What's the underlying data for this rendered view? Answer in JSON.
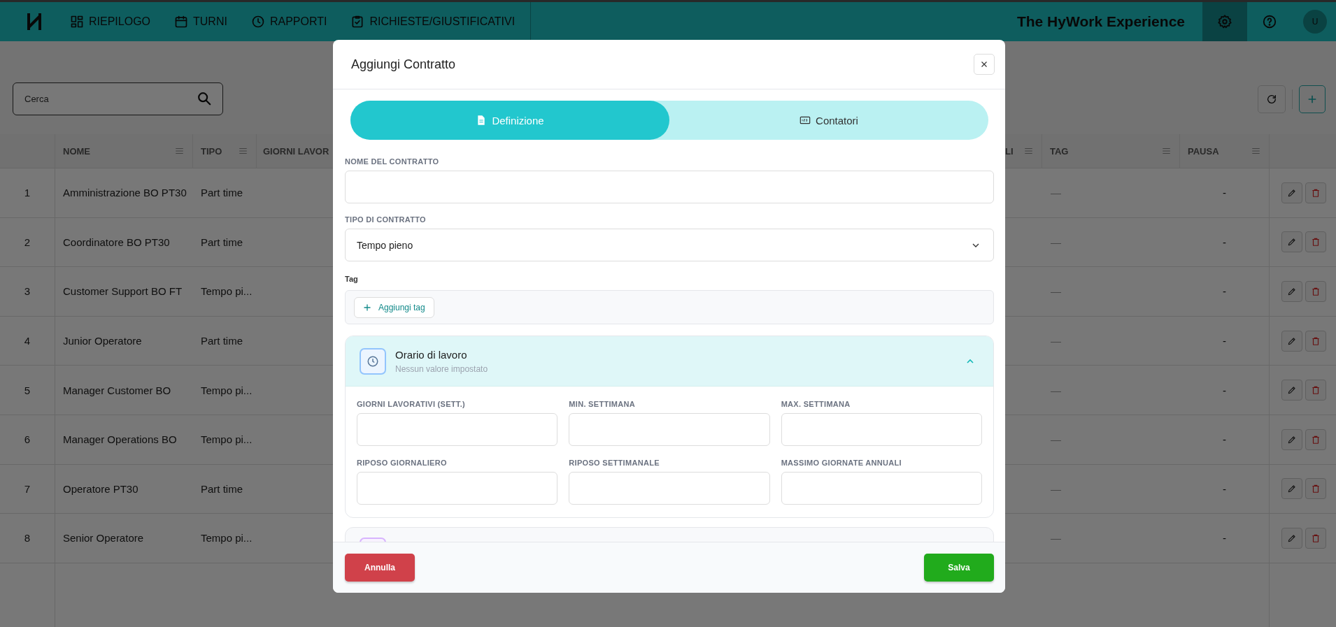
{
  "header": {
    "nav": [
      {
        "label": "RIEPILOGO"
      },
      {
        "label": "TURNI"
      },
      {
        "label": "RAPPORTI"
      },
      {
        "label": "RICHIESTE/GIUSTIFICATIVI"
      }
    ],
    "title": "The HyWork Experience",
    "settings": {
      "selected": true
    },
    "avatar": "U"
  },
  "toolbar": {
    "search": {
      "placeholder": "Cerca"
    }
  },
  "table": {
    "columns": [
      {
        "label": "NOME"
      },
      {
        "label": "TIPO"
      },
      {
        "label": "GIORNI LAVOR"
      },
      {
        "label": "LI"
      },
      {
        "label": "TAG"
      },
      {
        "label": "PAUSA"
      }
    ],
    "rows": [
      {
        "number": "1",
        "nome": "Amministrazione BO PT30",
        "tipo": "Part time",
        "tag": "—",
        "pausa": "-"
      },
      {
        "number": "2",
        "nome": "Coordinatore BO PT30",
        "tipo": "Part time",
        "tag": "—",
        "pausa": "-"
      },
      {
        "number": "3",
        "nome": "Customer Support BO FT",
        "tipo": "Tempo pi...",
        "tag": "—",
        "pausa": "-"
      },
      {
        "number": "4",
        "nome": "Junior Operatore",
        "tipo": "Part time",
        "tag": "—",
        "pausa": "-"
      },
      {
        "number": "5",
        "nome": "Manager Customer BO",
        "tipo": "Tempo pi...",
        "tag": "—",
        "pausa": "-"
      },
      {
        "number": "6",
        "nome": "Manager Operations BO",
        "tipo": "Tempo pi...",
        "tag": "—",
        "pausa": "-"
      },
      {
        "number": "7",
        "nome": "Operatore PT30",
        "tipo": "Part time",
        "tag": "—",
        "pausa": "-"
      },
      {
        "number": "8",
        "nome": "Senior Operatore",
        "tipo": "Tempo pi...",
        "tag": "—",
        "pausa": "-"
      }
    ]
  },
  "modal": {
    "title": "Aggiungi Contratto",
    "tabs": [
      {
        "label": "Definizione",
        "selected": true
      },
      {
        "label": "Contatori",
        "selected": false
      }
    ],
    "name_field": {
      "label": "NOME DEL CONTRATTO"
    },
    "type_field": {
      "label": "TIPO DI CONTRATTO",
      "value": "Tempo pieno"
    },
    "tags": {
      "label": "Tag",
      "add_button": "Aggiungi tag"
    },
    "sections": [
      {
        "title": "Orario di lavoro",
        "subtitle": "Nessun valore impostato",
        "expanded": true,
        "color": "#93c5fd",
        "fields": [
          {
            "label": "GIORNI LAVORATIVI (SETT.)"
          },
          {
            "label": "MIN. SETTIMANA"
          },
          {
            "label": "MAX. SETTIMANA"
          },
          {
            "label": "RIPOSO GIORNALIERO"
          },
          {
            "label": "RIPOSO SETTIMANALE"
          },
          {
            "label": "MASSIMO GIORNATE ANNUALI"
          }
        ]
      },
      {
        "expanded": false,
        "color": "#d8b4fe"
      }
    ],
    "buttons": {
      "cancel": "Annulla",
      "save": "Salva"
    }
  }
}
